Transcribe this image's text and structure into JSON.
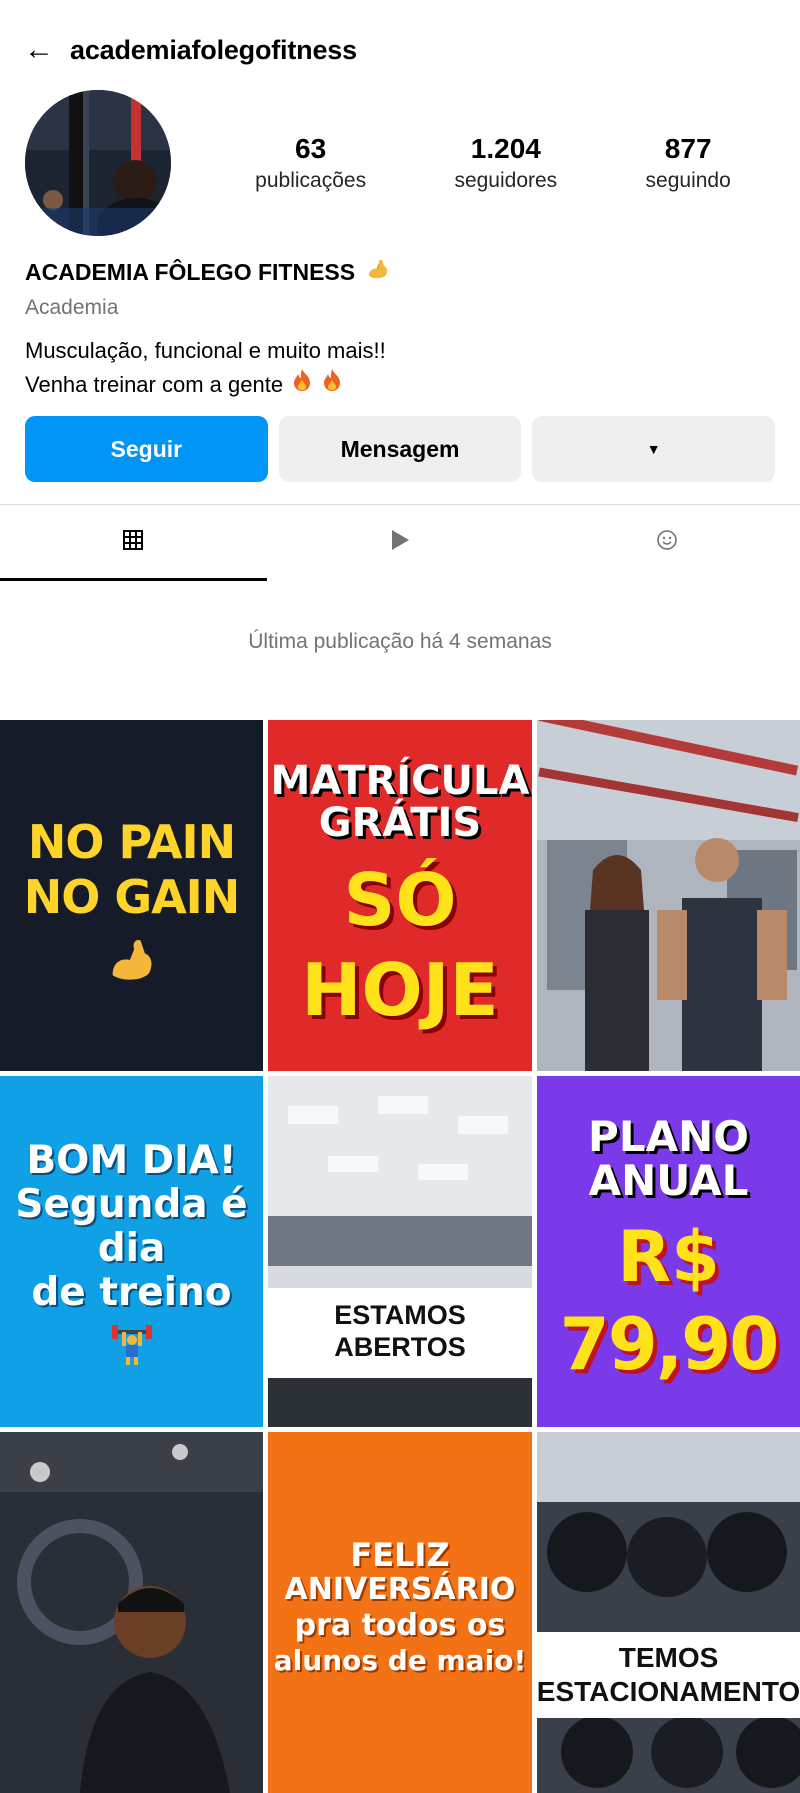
{
  "header": {
    "back_icon": "arrow-left-icon",
    "username": "academiafolegofitness"
  },
  "stats": [
    {
      "value": "63",
      "label": "publicações"
    },
    {
      "value": "1.204",
      "label": "seguidores"
    },
    {
      "value": "877",
      "label": "seguindo"
    }
  ],
  "profile": {
    "full_name": "ACADEMIA FÔLEGO FITNESS",
    "category": "Academia",
    "bio_line1": "Musculação, funcional e muito mais!!",
    "bio_line2": "Venha treinar com a gente"
  },
  "buttons": {
    "follow": "Seguir",
    "message": "Mensagem",
    "more_icon": "caret-down-icon"
  },
  "tabs": [
    {
      "name": "grid-icon",
      "active": true
    },
    {
      "name": "reels-play-icon",
      "active": false
    },
    {
      "name": "tagged-icon",
      "active": false
    }
  ],
  "last_post": "Última publicação há 4 semanas",
  "posts": {
    "p1": {
      "line1": "NO PAIN",
      "line2": "NO GAIN"
    },
    "p2": {
      "line1": "MATRÍCULA",
      "line2": "GRÁTIS",
      "line3": "SÓ",
      "line4": "HOJE"
    },
    "p4": {
      "line1": "BOM DIA!",
      "line2": "Segunda é",
      "line3": "dia",
      "line4": "de treino"
    },
    "p5": {
      "line1": "ESTAMOS",
      "line2": "ABERTOS"
    },
    "p6": {
      "line1": "PLANO",
      "line2": "ANUAL",
      "line3": "R$",
      "line4": "79,90"
    },
    "p8": {
      "line1": "FELIZ",
      "line2": "ANIVERSÁRIO",
      "line3": "pra todos os",
      "line4": "alunos de maio!"
    },
    "p9": {
      "line1": "TEMOS",
      "line2": "ESTACIONAMENTO"
    }
  },
  "colors": {
    "accent": "#0095f6",
    "post1_bg": "#151b29",
    "post2_bg": "#e02a2a",
    "post4_bg": "#0fa0e6",
    "post6_bg": "#7b3aea",
    "post8_bg": "#f47216",
    "yellow_text": "#ffe21a"
  }
}
